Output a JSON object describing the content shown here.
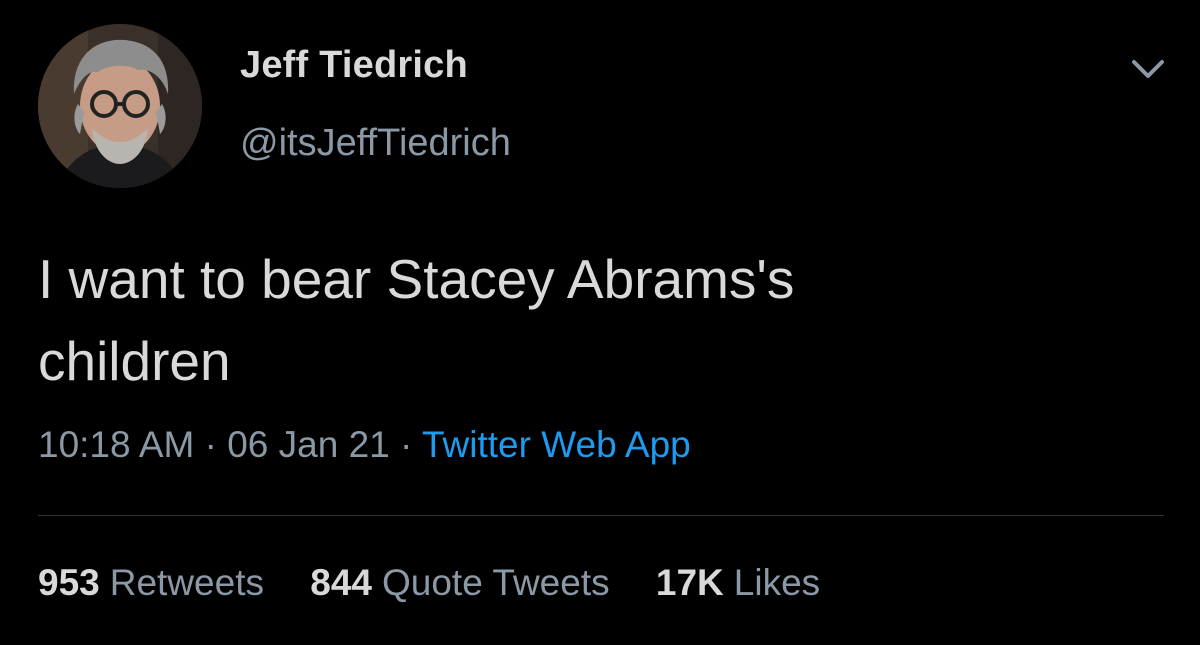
{
  "tweet": {
    "author": {
      "name": "Jeff Tiedrich",
      "handle": "@itsJeffTiedrich"
    },
    "text": "I want to bear Stacey Abrams's\nchildren",
    "time": "10:18 AM",
    "date": "06 Jan 21",
    "separator": "·",
    "source": "Twitter Web App",
    "stats": [
      {
        "count": "953",
        "label": "Retweets"
      },
      {
        "count": "844",
        "label": "Quote Tweets"
      },
      {
        "count": "17K",
        "label": "Likes"
      }
    ]
  },
  "icons": {
    "menu": "chevron-down-icon"
  },
  "colors": {
    "background": "#000000",
    "text": "#d9d9d9",
    "secondary": "#8b98a5",
    "link": "#1d9bf0",
    "divider": "#2f3336"
  }
}
